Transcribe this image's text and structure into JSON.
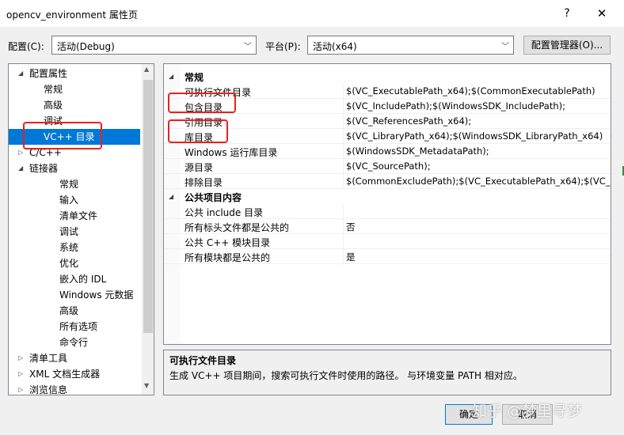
{
  "window": {
    "title": "opencv_environment 属性页",
    "help": "?",
    "close": "✕"
  },
  "toolbar": {
    "config_label": "配置(C):",
    "config_value": "活动(Debug)",
    "platform_label": "平台(P):",
    "platform_value": "活动(x64)",
    "manager_button": "配置管理器(O)..."
  },
  "tree": {
    "items": [
      {
        "label": "配置属性",
        "expander": "◢"
      },
      {
        "label": "常规"
      },
      {
        "label": "高级"
      },
      {
        "label": "调试"
      },
      {
        "label": "VC++ 目录",
        "selected": true
      },
      {
        "label": "C/C++",
        "expander": "▷"
      },
      {
        "label": "链接器",
        "expander": "◢"
      },
      {
        "label": "常规"
      },
      {
        "label": "输入"
      },
      {
        "label": "清单文件"
      },
      {
        "label": "调试"
      },
      {
        "label": "系统"
      },
      {
        "label": "优化"
      },
      {
        "label": "嵌入的 IDL"
      },
      {
        "label": "Windows 元数据"
      },
      {
        "label": "高级"
      },
      {
        "label": "所有选项"
      },
      {
        "label": "命令行"
      },
      {
        "label": "清单工具",
        "expander": "▷"
      },
      {
        "label": "XML 文档生成器",
        "expander": "▷"
      },
      {
        "label": "浏览信息",
        "expander": "▷"
      }
    ]
  },
  "grid": {
    "categories": [
      {
        "label": "常规",
        "rows": [
          {
            "name": "可执行文件目录",
            "value": "$(VC_ExecutablePath_x64);$(CommonExecutablePath)"
          },
          {
            "name": "包含目录",
            "value": "$(VC_IncludePath);$(WindowsSDK_IncludePath);"
          },
          {
            "name": "引用目录",
            "value": "$(VC_ReferencesPath_x64);"
          },
          {
            "name": "库目录",
            "value": "$(VC_LibraryPath_x64);$(WindowsSDK_LibraryPath_x64)"
          },
          {
            "name": "Windows 运行库目录",
            "value": "$(WindowsSDK_MetadataPath);"
          },
          {
            "name": "源目录",
            "value": "$(VC_SourcePath);"
          },
          {
            "name": "排除目录",
            "value": "$(CommonExcludePath);$(VC_ExecutablePath_x64);$(VC_Lil"
          }
        ]
      },
      {
        "label": "公共项目内容",
        "rows": [
          {
            "name": "公共 include 目录",
            "value": ""
          },
          {
            "name": "所有标头文件都是公共的",
            "value": "否"
          },
          {
            "name": "公共 C++ 模块目录",
            "value": ""
          },
          {
            "name": "所有模块都是公共的",
            "value": "是"
          }
        ]
      }
    ]
  },
  "description": {
    "title": "可执行文件目录",
    "text": "生成 VC++ 项目期间，搜索可执行文件时使用的路径。 与环境变量 PATH 相对应。"
  },
  "footer": {
    "ok": "确定",
    "cancel": "取消",
    "watermark": "知乎 @梦里寻梦"
  },
  "colors": {
    "selection": "#0078d7",
    "highlight": "#e8221c"
  }
}
